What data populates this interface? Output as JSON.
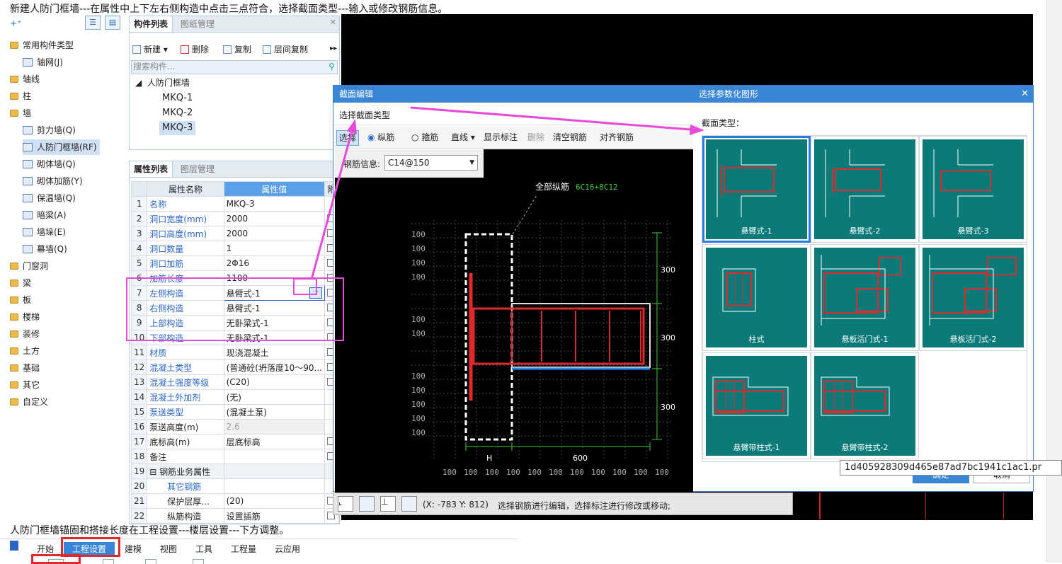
{
  "captions": {
    "top": "新建人防门框墙---在属性中上下左右侧构造中点击三点符合，选择截面类型---输入或修改钢筋信息。",
    "bottom": "人防门框墙锚固和搭接长度在工程设置---楼层设置---下方调整。"
  },
  "tree": {
    "items": [
      {
        "label": "常用构件类型",
        "level": 0
      },
      {
        "label": "轴网(J)",
        "level": 1
      },
      {
        "label": "轴线",
        "level": 0
      },
      {
        "label": "柱",
        "level": 0
      },
      {
        "label": "墙",
        "level": 0
      },
      {
        "label": "剪力墙(Q)",
        "level": 1
      },
      {
        "label": "人防门框墙(RF)",
        "level": 1,
        "selected": true
      },
      {
        "label": "砌体墙(Q)",
        "level": 1
      },
      {
        "label": "砌体加筋(Y)",
        "level": 1
      },
      {
        "label": "保温墙(Q)",
        "level": 1
      },
      {
        "label": "暗梁(A)",
        "level": 1
      },
      {
        "label": "墙垛(E)",
        "level": 1
      },
      {
        "label": "幕墙(Q)",
        "level": 1
      },
      {
        "label": "门窗洞",
        "level": 0
      },
      {
        "label": "梁",
        "level": 0
      },
      {
        "label": "板",
        "level": 0
      },
      {
        "label": "楼梯",
        "level": 0
      },
      {
        "label": "装修",
        "level": 0
      },
      {
        "label": "土方",
        "level": 0
      },
      {
        "label": "基础",
        "level": 0
      },
      {
        "label": "其它",
        "level": 0
      },
      {
        "label": "自定义",
        "level": 0
      }
    ]
  },
  "component_panel": {
    "tabs": [
      "构件列表",
      "图纸管理"
    ],
    "toolbar": [
      "新建",
      "删除",
      "复制",
      "层间复制"
    ],
    "search_placeholder": "搜索构件...",
    "group": "人防门框墙",
    "items": [
      "MKQ-1",
      "MKQ-2",
      "MKQ-3"
    ],
    "selected": "MKQ-3"
  },
  "property_panel": {
    "tabs": [
      "属性列表",
      "图层管理"
    ],
    "headers": [
      "属性名称",
      "属性值",
      "附"
    ],
    "rows": [
      {
        "n": "1",
        "name": "名称",
        "value": "MKQ-3",
        "blue": true,
        "chk": false
      },
      {
        "n": "2",
        "name": "洞口宽度(mm)",
        "value": "2000",
        "blue": true,
        "chk": true
      },
      {
        "n": "3",
        "name": "洞口高度(mm)",
        "value": "2000",
        "blue": true,
        "chk": true
      },
      {
        "n": "4",
        "name": "洞口数量",
        "value": "1",
        "blue": true,
        "chk": true
      },
      {
        "n": "5",
        "name": "洞口加筋",
        "value": "2Φ16",
        "blue": true,
        "chk": true
      },
      {
        "n": "6",
        "name": "加筋长度",
        "value": "1100",
        "blue": true,
        "chk": true
      },
      {
        "n": "7",
        "name": "左侧构造",
        "value": "悬臂式-1",
        "blue": true,
        "chk": true
      },
      {
        "n": "8",
        "name": "右侧构造",
        "value": "悬臂式-1",
        "blue": true,
        "chk": true
      },
      {
        "n": "9",
        "name": "上部构造",
        "value": "无卧梁式-1",
        "blue": true,
        "chk": true
      },
      {
        "n": "10",
        "name": "下部构造",
        "value": "无卧梁式-1",
        "blue": true,
        "chk": true
      },
      {
        "n": "11",
        "name": "材质",
        "value": "现浇混凝土",
        "blue": true,
        "chk": true
      },
      {
        "n": "12",
        "name": "混凝土类型",
        "value": "(普通砼(坍落度10～90...",
        "blue": true,
        "chk": true
      },
      {
        "n": "13",
        "name": "混凝土强度等级",
        "value": "(C20)",
        "blue": true,
        "chk": true
      },
      {
        "n": "14",
        "name": "混凝土外加剂",
        "value": "(无)",
        "blue": true,
        "chk": false
      },
      {
        "n": "15",
        "name": "泵送类型",
        "value": "(混凝土泵)",
        "blue": true,
        "chk": false
      },
      {
        "n": "16",
        "name": "泵送高度(m)",
        "value": "2.6",
        "blue": false,
        "chk": false,
        "grayval": true
      },
      {
        "n": "17",
        "name": "底标高(m)",
        "value": "层底标高",
        "blue": false,
        "chk": true
      },
      {
        "n": "18",
        "name": "备注",
        "value": "",
        "blue": false,
        "chk": true
      },
      {
        "n": "19",
        "name": "⊟ 钢筋业务属性",
        "value": "",
        "blue": false,
        "chk": false,
        "group": true
      },
      {
        "n": "20",
        "name": "其它钢筋",
        "value": "",
        "blue": true,
        "chk": false,
        "indent": true
      },
      {
        "n": "21",
        "name": "保护层厚...",
        "value": "(20)",
        "blue": false,
        "chk": true,
        "indent": true
      },
      {
        "n": "22",
        "name": "纵筋构造",
        "value": "设置插筋",
        "blue": false,
        "chk": true,
        "indent": true
      }
    ]
  },
  "section_dialog": {
    "title_left": "截面编辑",
    "title_right": "选择参数化图形",
    "select_type_button": "选择截面类型",
    "toolbar": [
      "选择",
      "纵筋",
      "箍筋",
      "直线",
      "显示标注",
      "删除",
      "清空钢筋",
      "对齐钢筋"
    ],
    "rebar_info_label": "钢筋信息:",
    "rebar_info_value": "C14@150",
    "annotation_label": "全部纵筋",
    "annotation_value": "6C16+8C12",
    "dim_right": [
      "300",
      "300",
      "300"
    ],
    "dim_bottom": [
      "H",
      "600"
    ],
    "grid_label": "100",
    "section_type_label": "截面类型：",
    "tiles": [
      "悬臂式-1",
      "悬臂式-2",
      "悬臂式-3",
      "柱式",
      "悬板活门式-1",
      "悬板活门式-2",
      "悬臂带柱式-1",
      "悬臂带柱式-2"
    ],
    "ok_button": "确定",
    "cancel_button": "取消",
    "tooltip": "1d405928309d465e87ad7bc1941c1ac1.pr"
  },
  "status": {
    "coords": "(X: -783 Y: 812)",
    "message": "选择钢筋进行编辑，选择标注进行修改或移动;"
  },
  "ribbon": {
    "tabs": [
      "开始",
      "工程设置",
      "建模",
      "视图",
      "工具",
      "工程量",
      "云应用"
    ],
    "active": "工程设置"
  },
  "colors": {
    "accent": "#3a86d6",
    "teal_tile": "#0b7a78",
    "rebar_red": "#e0292c",
    "magenta_annotation": "#e64ad9",
    "dim_green": "#3bd13b"
  }
}
